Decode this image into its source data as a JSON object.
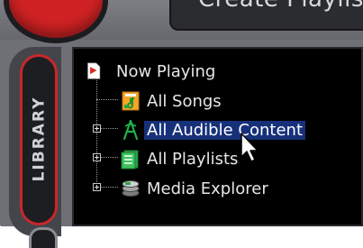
{
  "window": {
    "title_fragment": "Create Playlist"
  },
  "library_tab": {
    "label": "LIBRARY"
  },
  "tree": {
    "root": {
      "label": "Now Playing",
      "icon": "now-playing-icon"
    },
    "items": [
      {
        "label": "All Songs",
        "icon": "music-note-icon",
        "expandable": false,
        "selected": false
      },
      {
        "label": "All Audible Content",
        "icon": "audible-icon",
        "expandable": true,
        "selected": true
      },
      {
        "label": "All Playlists",
        "icon": "playlist-icon",
        "expandable": true,
        "selected": false
      },
      {
        "label": "Media Explorer",
        "icon": "media-explorer-icon",
        "expandable": true,
        "selected": false
      }
    ]
  },
  "colors": {
    "brand_red": "#d02224",
    "selection": "#16307a",
    "audible_green": "#21b04b",
    "skin_gray": "#6e7076"
  }
}
